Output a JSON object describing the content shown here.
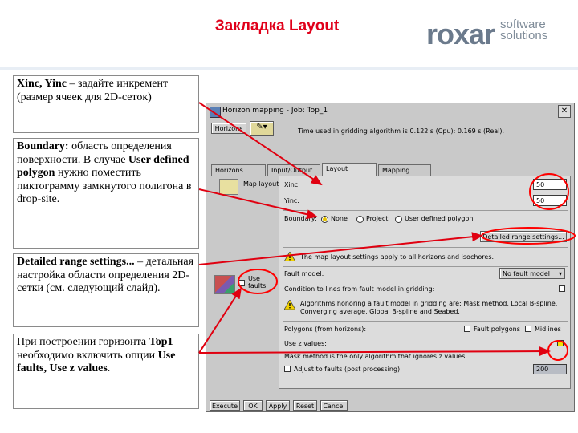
{
  "slide": {
    "title": "Закладка Layout",
    "logo_main": "roxar",
    "logo_sub1": "software",
    "logo_sub2": "solutions"
  },
  "notes": [
    {
      "html": "<b>Xinc, Yinc</b> – задайте инкремент (размер ячеек для 2D-сеток)"
    },
    {
      "html": "<b>Boundary:</b> область определения поверхности. В случае <b>User defined polygon</b> нужно поместить пиктограмму замкнутого полигона в drop-site."
    },
    {
      "html": "<b>Detailed range settings...</b> – детальная настройка области определения 2D-сетки (см. следующий слайд)."
    },
    {
      "html": "При построении горизонта <b>Top1</b> необходимо включить опции <b>Use faults, Use z values</b>."
    }
  ],
  "window": {
    "title": "Horizon mapping - Job: Top_1",
    "horizons_button": "Horizons",
    "time_text": "Time used in gridding algorithm is 0.122 s (Cpu): 0.169 s (Real).",
    "tabs": [
      "Horizons",
      "Input/Output",
      "Layout",
      "Mapping"
    ],
    "map_layout_label": "Map layout",
    "use_faults_label1": "Use",
    "use_faults_label2": "faults",
    "xinc_label": "Xinc:",
    "xinc_value": "50",
    "yinc_label": "Yinc:",
    "yinc_value": "50",
    "boundary_label": "Boundary:",
    "boundary_options": [
      "None",
      "Project",
      "User defined polygon"
    ],
    "detailed_button": "Detailed range settings...",
    "apply_note": "The map layout settings apply to all horizons and isochores.",
    "fault_model_label": "Fault model:",
    "fault_model_value": "No fault model",
    "condition_label": "Condition to lines from fault model in gridding:",
    "algo_note1": "Algorithms honoring a fault model in gridding are: Mask method, Local B-spline,",
    "algo_note2": "Converging average, Global B-spline and Seabed.",
    "polygons_label": "Polygons (from horizons):",
    "fault_polygons_label": "Fault polygons",
    "midlines_label": "Midlines",
    "use_z_label": "Use z values:",
    "mask_note": "Mask method is the only algorithm that ignores z values.",
    "adjust_label": "Adjust to faults (post processing)",
    "adjust_value": "200",
    "buttons": [
      "Execute",
      "OK",
      "Apply",
      "Reset",
      "Cancel"
    ]
  },
  "colors": {
    "title_red": "#e0001a",
    "arrow_red": "#e00010",
    "highlight_red": "#ff0000"
  }
}
